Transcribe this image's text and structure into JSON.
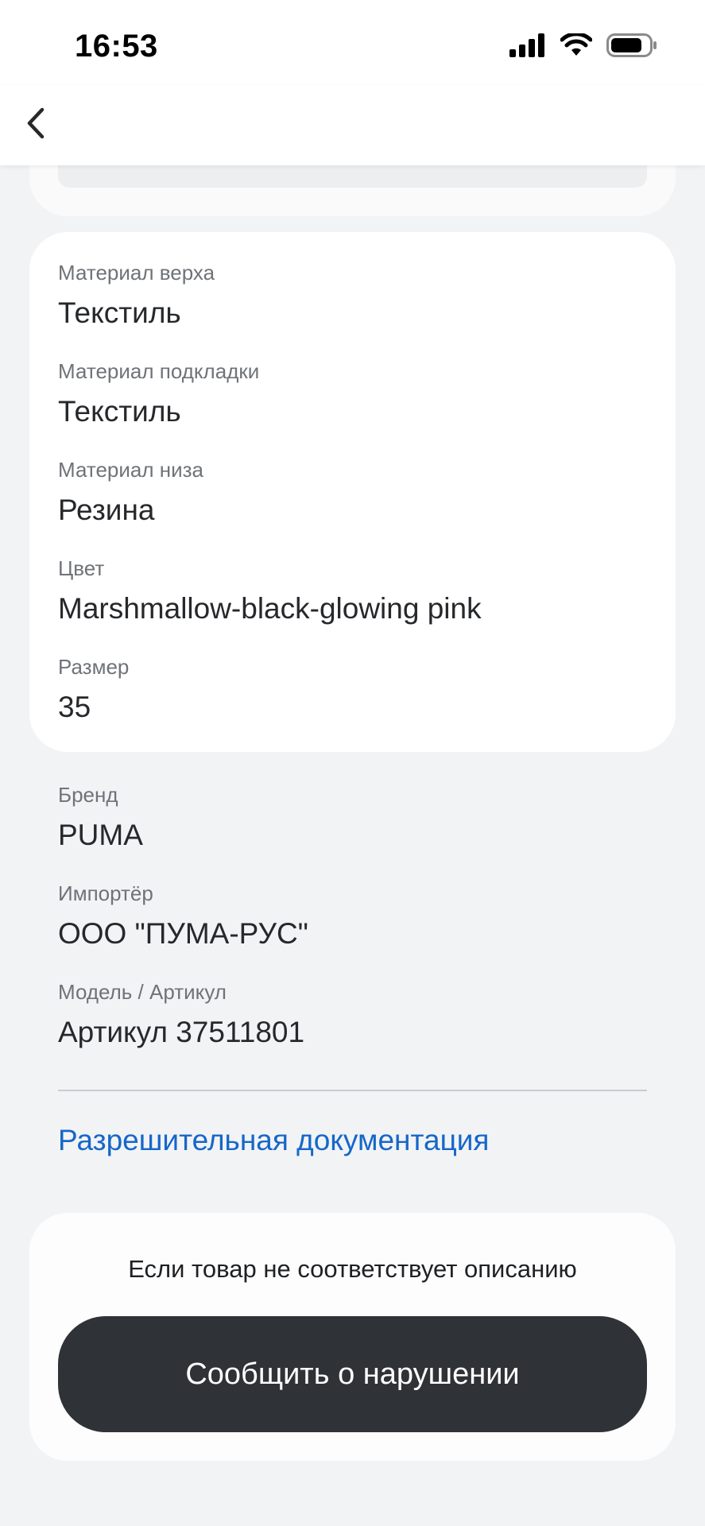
{
  "status_bar": {
    "time": "16:53",
    "icons": [
      "cellular-signal-icon",
      "wifi-icon",
      "battery-icon"
    ]
  },
  "nav": {
    "back_icon": "chevron-left-icon"
  },
  "properties": [
    {
      "label": "Материал верха",
      "value": "Текстиль"
    },
    {
      "label": "Материал подкладки",
      "value": "Текстиль"
    },
    {
      "label": "Материал низа",
      "value": "Резина"
    },
    {
      "label": "Цвет",
      "value": "Marshmallow-black-glowing pink"
    },
    {
      "label": "Размер",
      "value": "35"
    }
  ],
  "info": [
    {
      "label": "Бренд",
      "value": "PUMA"
    },
    {
      "label": "Импортёр",
      "value": "ООО \"ПУМА-РУС\""
    },
    {
      "label": "Модель / Артикул",
      "value": "Артикул 37511801"
    }
  ],
  "docs_link": "Разрешительная документация",
  "report": {
    "hint": "Если товар не соответствует описанию",
    "button_label": "Сообщить о нарушении"
  },
  "colors": {
    "background": "#f2f3f5",
    "card": "#ffffff",
    "link": "#1567c9",
    "button": "#2f3236"
  }
}
